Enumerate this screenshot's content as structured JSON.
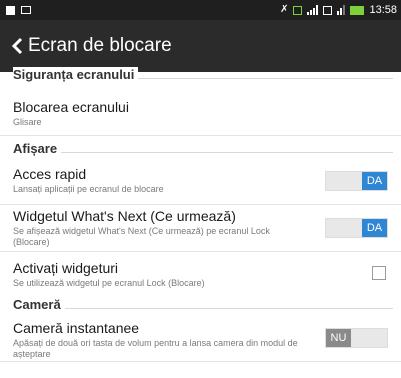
{
  "status_bar": {
    "time": "13:58"
  },
  "app_bar": {
    "title": "Ecran de blocare"
  },
  "sections": {
    "security": {
      "header": "Siguranța ecranului",
      "screen_lock": {
        "title": "Blocarea ecranului",
        "subtitle": "Glisare"
      }
    },
    "display": {
      "header": "Afișare",
      "quick_access": {
        "title": "Acces rapid",
        "subtitle": "Lansați aplicații pe ecranul de blocare",
        "toggle": "DA"
      },
      "whats_next": {
        "title": "Widgetul What's Next (Ce urmează)",
        "subtitle": "Se afișează widgetul What's Next (Ce urmează) pe ecranul Lock (Blocare)",
        "toggle": "DA"
      },
      "widgets": {
        "title": "Activați widgeturi",
        "subtitle": "Se utilizează widgetul pe ecranul Lock (Blocare)"
      }
    },
    "camera": {
      "header": "Cameră",
      "instant_camera": {
        "title": "Cameră instantanee",
        "subtitle": "Apăsați de două ori tasta de volum pentru a lansa camera din modul de așteptare",
        "toggle": "NU"
      }
    }
  }
}
